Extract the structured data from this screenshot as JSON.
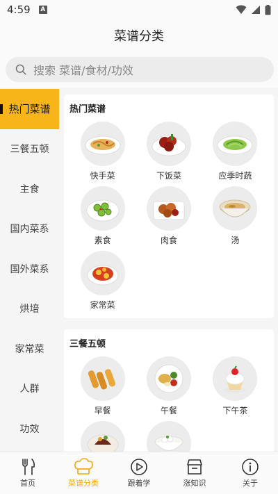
{
  "status": {
    "time": "4:59",
    "badge": "A"
  },
  "header": {
    "title": "菜谱分类"
  },
  "search": {
    "placeholder": "搜索 菜谱/食材/功效"
  },
  "sidebar": {
    "items": [
      {
        "label": "热门菜谱",
        "active": true
      },
      {
        "label": "三餐五顿"
      },
      {
        "label": "主食"
      },
      {
        "label": "国内菜系"
      },
      {
        "label": "国外菜系"
      },
      {
        "label": "烘培"
      },
      {
        "label": "家常菜"
      },
      {
        "label": "人群"
      },
      {
        "label": "功效"
      }
    ]
  },
  "sections": [
    {
      "title": "热门菜谱",
      "items": [
        {
          "label": "快手菜",
          "icon": "noodle-dish-icon"
        },
        {
          "label": "下饭菜",
          "icon": "braised-meat-icon"
        },
        {
          "label": "应季时蔬",
          "icon": "green-vegetables-icon"
        },
        {
          "label": "素食",
          "icon": "cucumber-salad-icon"
        },
        {
          "label": "肉食",
          "icon": "fried-meat-icon"
        },
        {
          "label": "汤",
          "icon": "soup-bowl-icon"
        },
        {
          "label": "家常菜",
          "icon": "tomato-egg-icon"
        }
      ]
    },
    {
      "title": "三餐五顿",
      "items": [
        {
          "label": "早餐",
          "icon": "spring-rolls-icon"
        },
        {
          "label": "午餐",
          "icon": "lunch-plate-icon"
        },
        {
          "label": "下午茶",
          "icon": "cupcake-icon"
        },
        {
          "label": "",
          "icon": "dinner-plate-icon"
        },
        {
          "label": "",
          "icon": "rice-bowl-icon"
        }
      ]
    }
  ],
  "tabbar": {
    "items": [
      {
        "label": "首页",
        "icon": "fork-knife-icon"
      },
      {
        "label": "菜谱分类",
        "icon": "chef-hat-icon",
        "active": true
      },
      {
        "label": "跟着学",
        "icon": "play-icon"
      },
      {
        "label": "涨知识",
        "icon": "store-icon"
      },
      {
        "label": "关于",
        "icon": "info-icon"
      }
    ]
  },
  "colors": {
    "accent": "#f8b51a",
    "tab_active": "#f3a712"
  }
}
